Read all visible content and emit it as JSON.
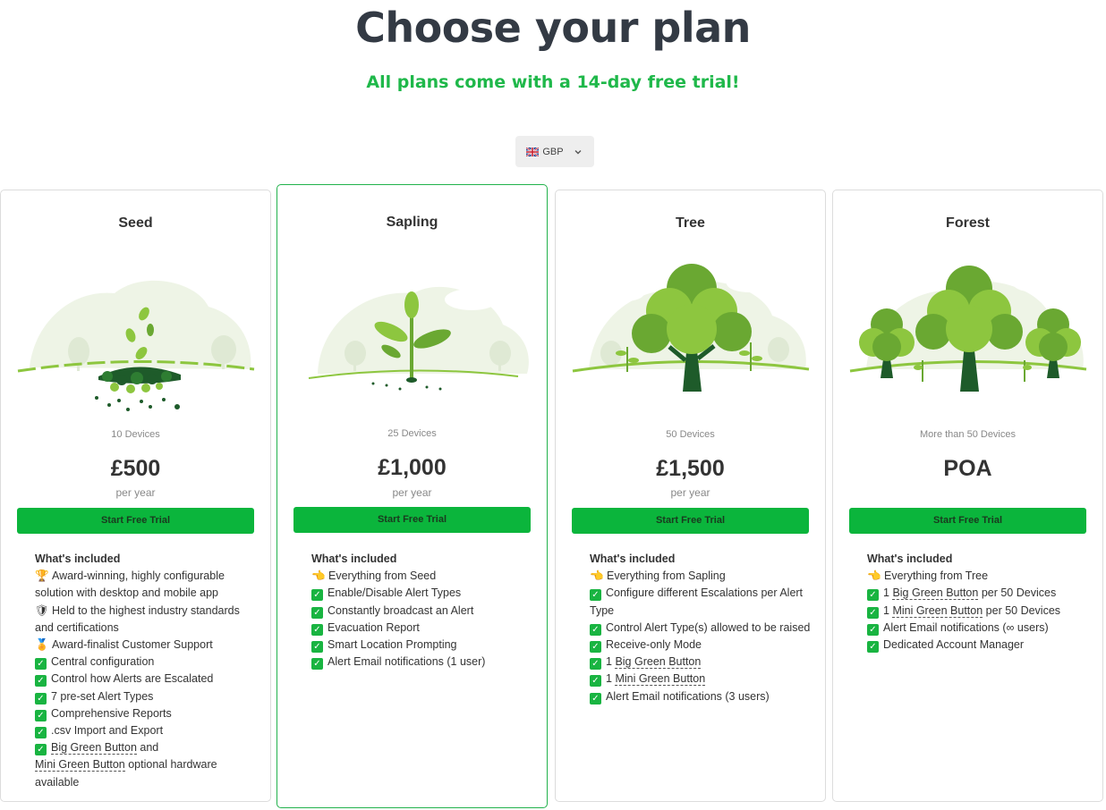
{
  "header": {
    "title": "Choose your plan",
    "subtitle": "All plans come with a 14-day free trial!"
  },
  "currency": {
    "selected": "GBP",
    "flag_icon": "uk-flag-icon",
    "chevron_icon": "chevron-down-icon"
  },
  "colors": {
    "accent": "#0bb53c",
    "subtitle": "#1fb84a",
    "title": "#333a44"
  },
  "plans": [
    {
      "name": "Seed",
      "devices": "10 Devices",
      "price": "£500",
      "period": "per year",
      "cta": "Start Free Trial",
      "included_label": "What's included",
      "features": [
        {
          "icon": "trophy-icon",
          "glyph": "🏆",
          "text": "Award-winning, highly configurable solution with desktop and mobile app"
        },
        {
          "icon": "shield-icon",
          "glyph": "🛡",
          "text": "Held to the highest industry standards and certifications"
        },
        {
          "icon": "medal-icon",
          "glyph": "🏅",
          "text": "Award-finalist Customer Support"
        },
        {
          "icon": "check-icon",
          "text": "Central configuration"
        },
        {
          "icon": "check-icon",
          "text": "Control how Alerts are Escalated"
        },
        {
          "icon": "check-icon",
          "text": "7 pre-set Alert Types"
        },
        {
          "icon": "check-icon",
          "text": "Comprehensive Reports"
        },
        {
          "icon": "check-icon",
          "text": ".csv Import and Export"
        },
        {
          "icon": "check-icon",
          "link1": "Big Green Button",
          "text_mid": " and",
          "link2": "Mini Green Button",
          "text_end": " optional hardware available"
        }
      ]
    },
    {
      "name": "Sapling",
      "devices": "25 Devices",
      "price": "£1,000",
      "period": "per year",
      "cta": "Start Free Trial",
      "included_label": "What's included",
      "features": [
        {
          "icon": "pointing-hand-icon",
          "glyph": "👈",
          "text": "Everything from Seed"
        },
        {
          "icon": "check-icon",
          "text": "Enable/Disable Alert Types"
        },
        {
          "icon": "check-icon",
          "text": "Constantly broadcast an Alert"
        },
        {
          "icon": "check-icon",
          "text": "Evacuation Report"
        },
        {
          "icon": "check-icon",
          "text": "Smart Location Prompting"
        },
        {
          "icon": "check-icon",
          "text": "Alert Email notifications (1 user)"
        }
      ]
    },
    {
      "name": "Tree",
      "devices": "50 Devices",
      "price": "£1,500",
      "period": "per year",
      "cta": "Start Free Trial",
      "included_label": "What's included",
      "features": [
        {
          "icon": "pointing-hand-icon",
          "glyph": "👈",
          "text": "Everything from Sapling"
        },
        {
          "icon": "check-icon",
          "text": "Configure different Escalations per Alert Type"
        },
        {
          "icon": "check-icon",
          "text": "Control Alert Type(s) allowed to be raised"
        },
        {
          "icon": "check-icon",
          "text": "Receive-only Mode"
        },
        {
          "icon": "check-icon",
          "pre": "1 ",
          "link1": "Big Green Button"
        },
        {
          "icon": "check-icon",
          "pre": "1 ",
          "link1": "Mini Green Button"
        },
        {
          "icon": "check-icon",
          "text": "Alert Email notifications (3 users)"
        }
      ]
    },
    {
      "name": "Forest",
      "devices": "More than 50 Devices",
      "price": "POA",
      "period": "",
      "cta": "Start Free Trial",
      "included_label": "What's included",
      "features": [
        {
          "icon": "pointing-hand-icon",
          "glyph": "👈",
          "text": "Everything from Tree"
        },
        {
          "icon": "check-icon",
          "pre": "1 ",
          "link1": "Big Green Button",
          "text_end": " per 50 Devices"
        },
        {
          "icon": "check-icon",
          "pre": "1 ",
          "link1": "Mini Green Button",
          "text_end": " per 50 Devices"
        },
        {
          "icon": "check-icon",
          "text": "Alert Email notifications (∞ users)"
        },
        {
          "icon": "check-icon",
          "text": "Dedicated Account Manager"
        }
      ]
    }
  ]
}
